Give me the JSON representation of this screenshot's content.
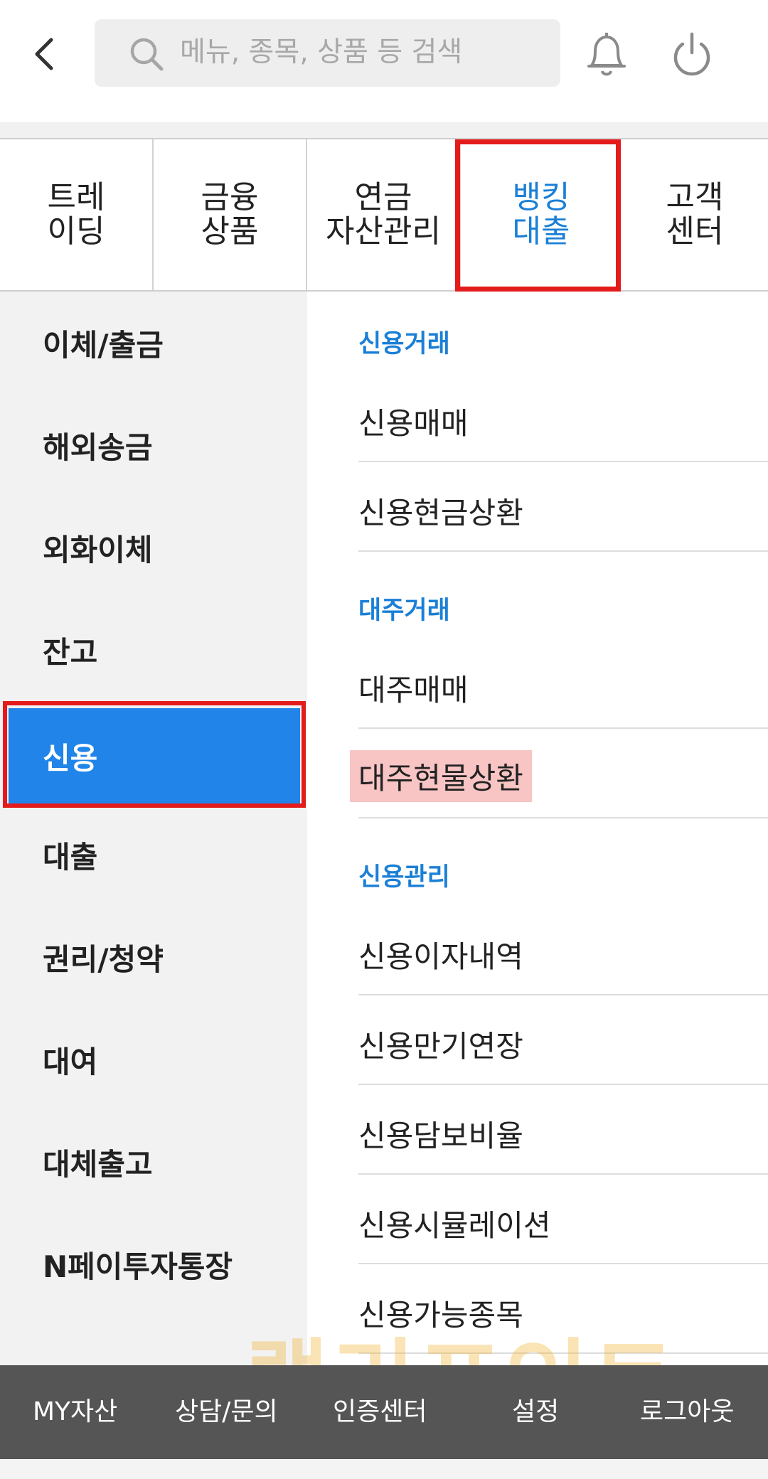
{
  "header": {
    "search_placeholder": "메뉴, 종목, 상품 등 검색",
    "icons": [
      "back-arrow-icon",
      "search-icon",
      "bell-icon",
      "power-icon"
    ]
  },
  "tabs": [
    {
      "label": "트레\n이딩"
    },
    {
      "label": "금융\n상품"
    },
    {
      "label": "연금\n자산관리"
    },
    {
      "label": "뱅킹\n대출",
      "active": true
    },
    {
      "label": "고객\n센터"
    }
  ],
  "sidebar": {
    "items": [
      {
        "label": "이체/출금"
      },
      {
        "label": "해외송금"
      },
      {
        "label": "외화이체"
      },
      {
        "label": "잔고"
      },
      {
        "label": "신용",
        "selected": true
      },
      {
        "label": "대출"
      },
      {
        "label": "권리/청약"
      },
      {
        "label": "대여"
      },
      {
        "label": "대체출고"
      },
      {
        "label": "N페이투자통장"
      }
    ]
  },
  "content": {
    "sections": [
      {
        "title": "신용거래",
        "items": [
          "신용매매",
          "신용현금상환"
        ]
      },
      {
        "title": "대주거래",
        "items": [
          "대주매매",
          "대주현물상환"
        ]
      },
      {
        "title": "신용관리",
        "items": [
          "신용이자내역",
          "신용만기연장",
          "신용담보비율",
          "신용시뮬레이션",
          "신용가능종목"
        ]
      }
    ],
    "highlighted_item": "대주현물상환"
  },
  "bottom_bar": {
    "items": [
      "MY자산",
      "상담/문의",
      "인증센터",
      "설정",
      "로그아웃"
    ]
  },
  "watermark": "랠리포인트",
  "colors": {
    "accent_blue": "#1a7fd6",
    "selected_bg": "#2084e8",
    "outline_red": "#e31b1b",
    "highlight_pink": "#f8c4c4",
    "bottom_bar_bg": "#555555"
  }
}
